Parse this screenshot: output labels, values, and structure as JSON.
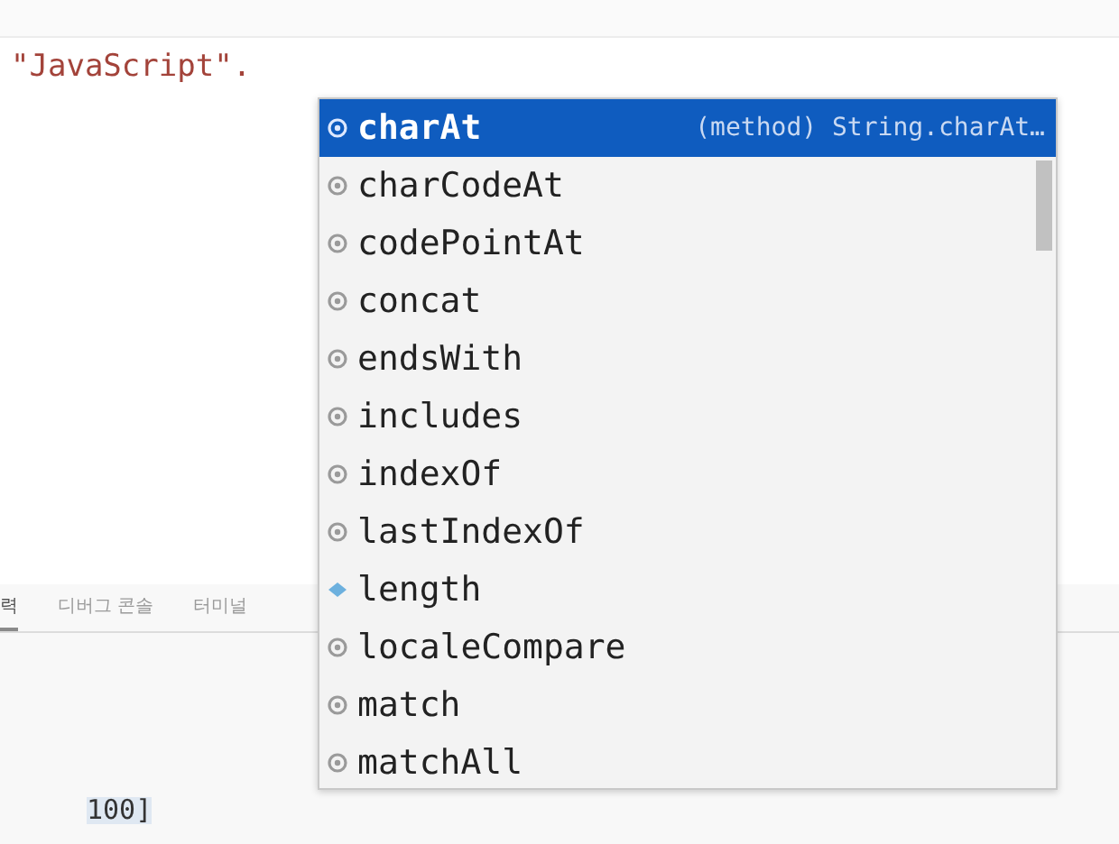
{
  "editor": {
    "code_line": "\"JavaScript\".",
    "bottom_line": "100]"
  },
  "suggestions": [
    {
      "label": "charAt",
      "kind": "method",
      "selected": true,
      "detail": "(method) String.charAt…"
    },
    {
      "label": "charCodeAt",
      "kind": "method",
      "selected": false
    },
    {
      "label": "codePointAt",
      "kind": "method",
      "selected": false
    },
    {
      "label": "concat",
      "kind": "method",
      "selected": false
    },
    {
      "label": "endsWith",
      "kind": "method",
      "selected": false
    },
    {
      "label": "includes",
      "kind": "method",
      "selected": false
    },
    {
      "label": "indexOf",
      "kind": "method",
      "selected": false
    },
    {
      "label": "lastIndexOf",
      "kind": "method",
      "selected": false
    },
    {
      "label": "length",
      "kind": "property",
      "selected": false
    },
    {
      "label": "localeCompare",
      "kind": "method",
      "selected": false
    },
    {
      "label": "match",
      "kind": "method",
      "selected": false
    },
    {
      "label": "matchAll",
      "kind": "method",
      "selected": false
    }
  ],
  "panel": {
    "tabs": [
      {
        "label": "력",
        "selected": true
      },
      {
        "label": "디버그 콘솔",
        "selected": false
      },
      {
        "label": "터미널",
        "selected": false
      }
    ]
  }
}
